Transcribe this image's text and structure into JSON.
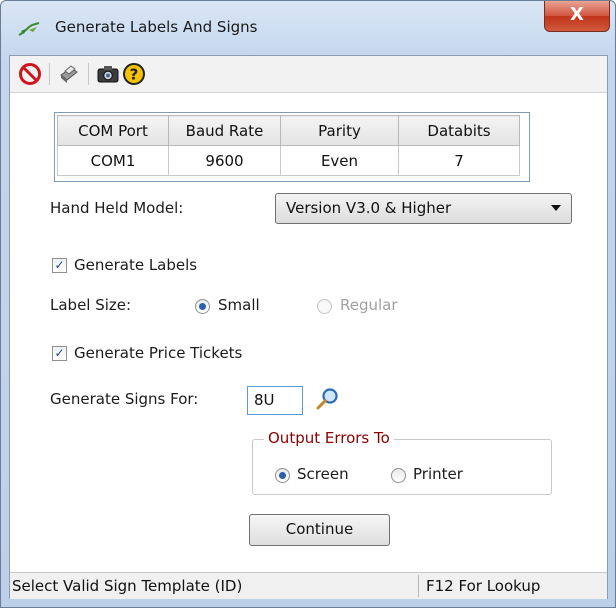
{
  "window": {
    "title": "Generate Labels And Signs",
    "close_label": "X"
  },
  "toolbar": {
    "items": [
      {
        "icon": "stop-icon"
      },
      {
        "icon": "printer-icon"
      },
      {
        "icon": "camera-icon"
      },
      {
        "icon": "help-icon"
      }
    ]
  },
  "comm_table": {
    "headers": [
      "COM Port",
      "Baud Rate",
      "Parity",
      "Databits"
    ],
    "rows": [
      [
        "COM1",
        "9600",
        "Even",
        "7"
      ]
    ]
  },
  "hand_held": {
    "label": "Hand Held Model:",
    "selected": "Version V3.0 & Higher"
  },
  "generate_labels": {
    "label": "Generate Labels",
    "checked": true
  },
  "label_size": {
    "label": "Label Size:",
    "options": [
      {
        "label": "Small",
        "selected": true,
        "enabled": true
      },
      {
        "label": "Regular",
        "selected": false,
        "enabled": false
      }
    ]
  },
  "price_tickets": {
    "label": "Generate Price Tickets",
    "checked": true
  },
  "signs": {
    "label": "Generate Signs For:",
    "value": "8U"
  },
  "output_errors": {
    "title": "Output  Errors To",
    "options": [
      {
        "label": "Screen",
        "selected": true
      },
      {
        "label": "Printer",
        "selected": false
      }
    ]
  },
  "continue_button": {
    "label": "Continue"
  },
  "status_bar": {
    "message": "Select Valid Sign Template (ID)",
    "hint": "F12 For Lookup"
  },
  "colors": {
    "title_bar": "#c4d6ee",
    "close_button": "#c1341b",
    "group_title": "#8b0000",
    "radio_dot": "#2c5ea9"
  }
}
